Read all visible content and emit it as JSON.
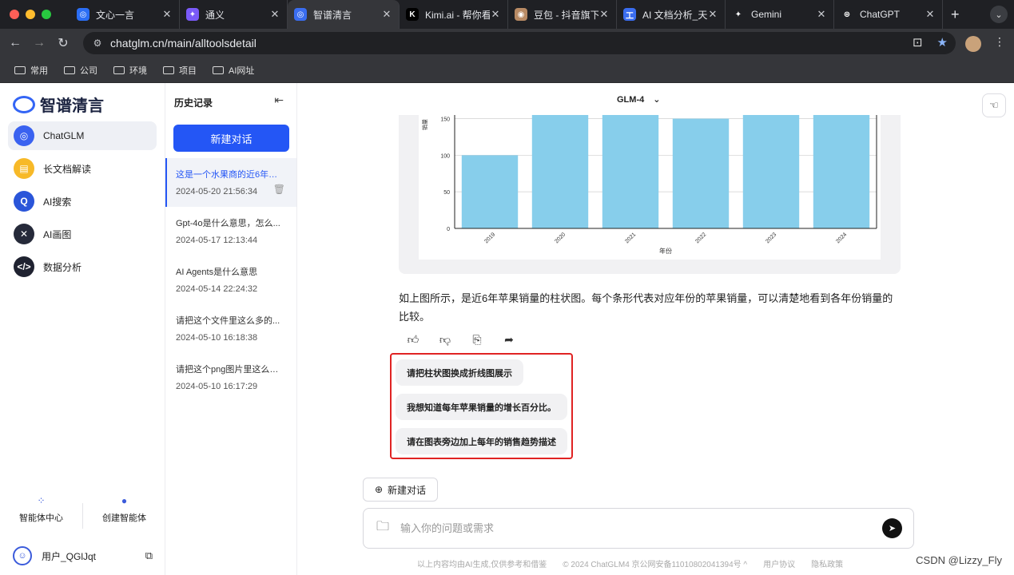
{
  "browser": {
    "tabs": [
      {
        "title": "文心一言",
        "icon": "wenxin-icon",
        "color": "#2b6ef5",
        "glyph": "◎"
      },
      {
        "title": "通义",
        "icon": "tongyi-icon",
        "color": "#7a5af8",
        "glyph": "✦"
      },
      {
        "title": "智谱清言",
        "icon": "zhipu-icon",
        "color": "#3a6df0",
        "glyph": "◎",
        "active": true
      },
      {
        "title": "Kimi.ai - 帮你看",
        "icon": "kimi-icon",
        "color": "#000000",
        "glyph": "K"
      },
      {
        "title": "豆包 - 抖音旗下",
        "icon": "doubao-icon",
        "color": "#b88a64",
        "glyph": "◉"
      },
      {
        "title": "AI 文档分析_天",
        "icon": "doc-ai-icon",
        "color": "#3a6df0",
        "glyph": "工"
      },
      {
        "title": "Gemini",
        "icon": "gemini-icon",
        "color": "#1f2024",
        "glyph": "✦"
      },
      {
        "title": "ChatGPT",
        "icon": "chatgpt-icon",
        "color": "#1f2024",
        "glyph": "⊛"
      }
    ],
    "url": "chatglm.cn/main/alltoolsdetail",
    "bookmarks": [
      "常用",
      "公司",
      "环境",
      "项目",
      "AI网址"
    ]
  },
  "sidebar": {
    "logo": "智谱清言",
    "items": [
      {
        "label": "ChatGLM",
        "icon": "chatglm-icon",
        "color": "#3a62f0",
        "glyph": "◎",
        "active": true
      },
      {
        "label": "长文档解读",
        "icon": "document-icon",
        "color": "#f7b928",
        "glyph": "▤"
      },
      {
        "label": "AI搜索",
        "icon": "search-icon",
        "color": "#2a55d9",
        "glyph": "Q"
      },
      {
        "label": "AI画图",
        "icon": "paint-icon",
        "color": "#262a3a",
        "glyph": "✕"
      },
      {
        "label": "数据分析",
        "icon": "code-icon",
        "color": "#1f2230",
        "glyph": "</>"
      }
    ],
    "bottom": [
      {
        "label": "智能体中心",
        "icon": "agent-center-icon",
        "glyph": "⁘"
      },
      {
        "label": "创建智能体",
        "icon": "create-agent-icon",
        "glyph": "●"
      }
    ],
    "user": "用户_QGlJqt"
  },
  "history": {
    "title": "历史记录",
    "new_chat": "新建对话",
    "items": [
      {
        "title": "这是一个水果商的近6年的...",
        "date": "2024-05-20 21:56:34",
        "active": true
      },
      {
        "title": "Gpt-4o是什么意思，怎么...",
        "date": "2024-05-17 12:13:44"
      },
      {
        "title": "AI Agents是什么意思",
        "date": "2024-05-14 22:24:32"
      },
      {
        "title": "请把这个文件里这么多的...",
        "date": "2024-05-10 16:18:38"
      },
      {
        "title": "请把这个png图片里这么多...",
        "date": "2024-05-10 16:17:29"
      }
    ]
  },
  "main": {
    "model": "GLM-4",
    "answer": "如上图所示，是近6年苹果销量的柱状图。每个条形代表对应年份的苹果销量，可以清楚地看到各年份销量的比较。",
    "suggestions": [
      "请把柱状图换成折线图展示",
      "我想知道每年苹果销量的增长百分比。",
      "请在图表旁边加上每年的销售趋势描述"
    ],
    "new_chat": "新建对话",
    "input_placeholder": "输入你的问题或需求",
    "footer": [
      "以上内容均由AI生成,仅供参考和借鉴",
      "© 2024 ChatGLM4 京公网安备11010802041394号 ^",
      "用户协议",
      "隐私政策"
    ],
    "watermark": "CSDN @Lizzy_Fly"
  },
  "chart_data": {
    "type": "bar",
    "categories": [
      "2019",
      "2020",
      "2021",
      "2022",
      "2023",
      "2024"
    ],
    "values": [
      100,
      155,
      155,
      150,
      155,
      155
    ],
    "xlabel": "年份",
    "ylabel": "销量",
    "yticks": [
      0,
      50,
      100,
      150
    ],
    "ylim": [
      0,
      155
    ],
    "bar_color": "#87ceeb",
    "grid": true
  }
}
